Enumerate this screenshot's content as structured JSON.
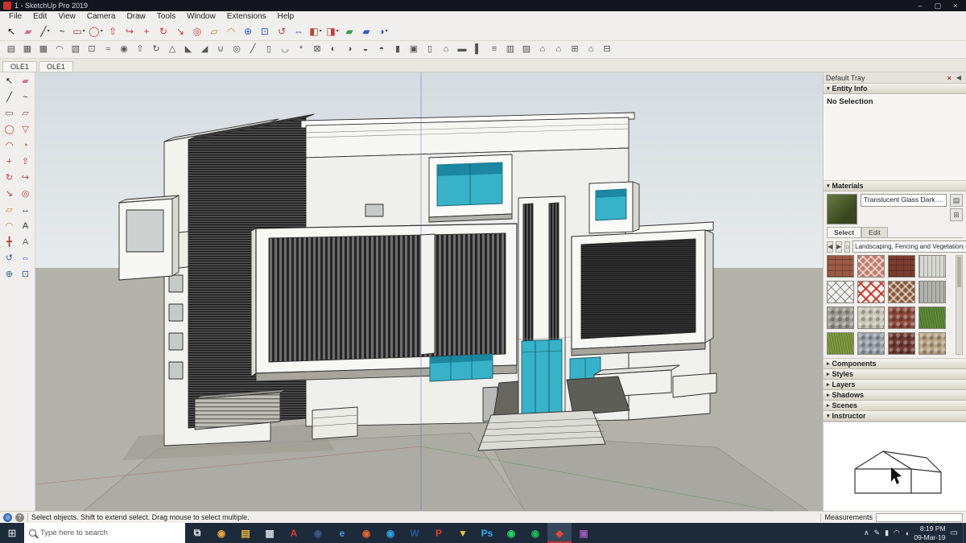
{
  "window": {
    "title": "1 - SketchUp Pro 2019",
    "controls": [
      {
        "name": "minimize-button",
        "glyph": "–"
      },
      {
        "name": "maximize-button",
        "glyph": "▢"
      },
      {
        "name": "close-button",
        "glyph": "×"
      }
    ]
  },
  "menu_bar": {
    "items": [
      "File",
      "Edit",
      "View",
      "Camera",
      "Draw",
      "Tools",
      "Window",
      "Extensions",
      "Help"
    ]
  },
  "toolbar_main": {
    "tools": [
      {
        "name": "select-tool",
        "glyph": "↖",
        "color": "#1b1b1b"
      },
      {
        "name": "eraser-tool",
        "glyph": "▰",
        "color": "#d4758c"
      },
      {
        "name": "line-tool",
        "glyph": "╱",
        "color": "#2b2b2b",
        "caret": true
      },
      {
        "name": "freehand-tool",
        "glyph": "~",
        "color": "#2b2b2b"
      },
      {
        "name": "rectangle-tool",
        "glyph": "▭",
        "color": "#9c4a3a",
        "caret": true
      },
      {
        "name": "circle-tool",
        "glyph": "◯",
        "color": "#c23b2e",
        "caret": true
      },
      {
        "name": "pushpull-tool",
        "glyph": "⇧",
        "color": "#c23b2e"
      },
      {
        "name": "followme-tool",
        "glyph": "↪",
        "color": "#c23b2e"
      },
      {
        "name": "move-tool",
        "glyph": "+",
        "color": "#c23b2e"
      },
      {
        "name": "rotate-tool",
        "glyph": "↻",
        "color": "#c23b2e"
      },
      {
        "name": "scale-tool",
        "glyph": "↘",
        "color": "#c23b2e"
      },
      {
        "name": "offset-tool",
        "glyph": "◎",
        "color": "#c23b2e"
      },
      {
        "name": "tape-measure-tool",
        "glyph": "▱",
        "color": "#b8872a"
      },
      {
        "name": "protractor-tool",
        "glyph": "◠",
        "color": "#b8872a"
      },
      {
        "name": "zoom-tool",
        "glyph": "⊕",
        "color": "#2a5ac0"
      },
      {
        "name": "zoom-extents-tool",
        "glyph": "⊡",
        "color": "#2a5ac0"
      },
      {
        "name": "orbit-tool",
        "glyph": "↺",
        "color": "#c23b2e"
      },
      {
        "name": "pan-tool",
        "glyph": "⇔",
        "color": "#2a5ac0"
      },
      {
        "name": "make-component-tool",
        "glyph": "◧",
        "color": "#c23b2e",
        "caret": true
      },
      {
        "name": "group-tool",
        "glyph": "◨",
        "color": "#c23b2e",
        "caret": true
      },
      {
        "name": "section-plane-tool",
        "glyph": "▰",
        "color": "#3a9a4a"
      },
      {
        "name": "section-display-tool",
        "glyph": "▰",
        "color": "#2a5ac0"
      },
      {
        "name": "shadows-toggle-tool",
        "glyph": "◑",
        "color": "#2a5ac0",
        "caret": true
      }
    ]
  },
  "toolbar_secondary": {
    "tools": [
      {
        "name": "offset-surface-tool",
        "glyph": "▤"
      },
      {
        "name": "quad-face-tool",
        "glyph": "▦"
      },
      {
        "name": "grid-tool",
        "glyph": "▩"
      },
      {
        "name": "soften-edges-tool",
        "glyph": "◠"
      },
      {
        "name": "drape-tool",
        "glyph": "▧"
      },
      {
        "name": "stamp-tool",
        "glyph": "⊡"
      },
      {
        "name": "from-contours-tool",
        "glyph": "≈"
      },
      {
        "name": "smoove-tool",
        "glyph": "◉"
      },
      {
        "name": "extrude-tool",
        "glyph": "⇧"
      },
      {
        "name": "lathe-tool",
        "glyph": "↻"
      },
      {
        "name": "taper-tool",
        "glyph": "△"
      },
      {
        "name": "bevel-tool",
        "glyph": "◣"
      },
      {
        "name": "chamfer-tool",
        "glyph": "◢"
      },
      {
        "name": "loft-tool",
        "glyph": "∪"
      },
      {
        "name": "pipe-tool",
        "glyph": "◎"
      },
      {
        "name": "slice-tool",
        "glyph": "╱"
      },
      {
        "name": "mirror-tool",
        "glyph": "▯"
      },
      {
        "name": "weld-edges-tool",
        "glyph": "◡"
      },
      {
        "name": "explode-tool",
        "glyph": "*"
      },
      {
        "name": "intersect-faces-tool",
        "glyph": "⊠"
      },
      {
        "name": "solid-union-tool",
        "glyph": "◐"
      },
      {
        "name": "solid-subtract-tool",
        "glyph": "◑"
      },
      {
        "name": "solid-trim-tool",
        "glyph": "◒"
      },
      {
        "name": "solid-intersect-tool",
        "glyph": "◓"
      },
      {
        "name": "wall-tool",
        "glyph": "▮"
      },
      {
        "name": "window-tool",
        "glyph": "▣"
      },
      {
        "name": "door-tool",
        "glyph": "▯"
      },
      {
        "name": "roof-tool",
        "glyph": "⌂"
      },
      {
        "name": "floor-tool",
        "glyph": "▬"
      },
      {
        "name": "column-tool",
        "glyph": "▌"
      },
      {
        "name": "stairs-tool",
        "glyph": "≡"
      },
      {
        "name": "fence-tool",
        "glyph": "▥"
      },
      {
        "name": "hatch-pattern-tool",
        "glyph": "▨"
      },
      {
        "name": "component-house-tool",
        "glyph": "⌂"
      },
      {
        "name": "3d-warehouse-tool",
        "glyph": "⌂"
      },
      {
        "name": "share-model-tool",
        "glyph": "⊞"
      },
      {
        "name": "model-info-tool",
        "glyph": "⌂"
      },
      {
        "name": "print-tool",
        "glyph": "⊟"
      }
    ]
  },
  "scene_tabs": [
    "OLE1",
    "OLE1"
  ],
  "left_toolbar": {
    "tools": [
      {
        "name": "select-tool",
        "glyph": "↖",
        "color": "#1b1b1b"
      },
      {
        "name": "eraser-tool",
        "glyph": "▰",
        "color": "#d4758c"
      },
      {
        "name": "line-tool",
        "glyph": "╱",
        "color": "#2b2b2b"
      },
      {
        "name": "freehand-tool",
        "glyph": "~",
        "color": "#2b2b2b"
      },
      {
        "name": "rectangle-tool",
        "glyph": "▭",
        "color": "#9c4a3a"
      },
      {
        "name": "rotated-rectangle-tool",
        "glyph": "▱",
        "color": "#9c4a3a"
      },
      {
        "name": "circle-tool",
        "glyph": "◯",
        "color": "#c23b2e"
      },
      {
        "name": "polygon-tool",
        "glyph": "▽",
        "color": "#c23b2e"
      },
      {
        "name": "arc-tool",
        "glyph": "◠",
        "color": "#c23b2e"
      },
      {
        "name": "pie-tool",
        "glyph": "◔",
        "color": "#c23b2e"
      },
      {
        "name": "move-tool",
        "glyph": "+",
        "color": "#c23b2e"
      },
      {
        "name": "pushpull-tool",
        "glyph": "⇧",
        "color": "#c23b2e"
      },
      {
        "name": "rotate-tool",
        "glyph": "↻",
        "color": "#c23b2e"
      },
      {
        "name": "followme-tool",
        "glyph": "↪",
        "color": "#c23b2e"
      },
      {
        "name": "scale-tool",
        "glyph": "↘",
        "color": "#c23b2e"
      },
      {
        "name": "offset-tool",
        "glyph": "◎",
        "color": "#c23b2e"
      },
      {
        "name": "tape-measure-tool",
        "glyph": "▱",
        "color": "#b8872a"
      },
      {
        "name": "dimension-tool",
        "glyph": "↔",
        "color": "#2b2b2b"
      },
      {
        "name": "protractor-tool",
        "glyph": "◠",
        "color": "#b8872a"
      },
      {
        "name": "text-tool",
        "glyph": "A",
        "color": "#2b2b2b"
      },
      {
        "name": "axes-tool",
        "glyph": "╋",
        "color": "#c23b2e"
      },
      {
        "name": "3d-text-tool",
        "glyph": "A",
        "color": "#666666"
      },
      {
        "name": "orbit-tool",
        "glyph": "↺",
        "color": "#2a5ac0"
      },
      {
        "name": "pan-tool",
        "glyph": "⇔",
        "color": "#2a5ac0"
      },
      {
        "name": "zoom-tool",
        "glyph": "⊕",
        "color": "#2a5ac0"
      },
      {
        "name": "zoom-extents-tool",
        "glyph": "⊡",
        "color": "#2a5ac0"
      }
    ]
  },
  "tray": {
    "title": "Default Tray",
    "close_glyph": "×",
    "hide_glyph": "◀",
    "entity_info": {
      "label": "Entity Info",
      "arrow": "▾",
      "status": "No Selection"
    },
    "materials": {
      "label": "Materials",
      "arrow": "▾",
      "material_name": "Translucent Glass Dark Green",
      "preview_color": "#55682f",
      "tabs": [
        {
          "name": "materials-tab-select",
          "label": "Select",
          "state": "active"
        },
        {
          "name": "materials-tab-edit",
          "label": "Edit"
        }
      ],
      "back_glyph": "◀",
      "forward_glyph": "▶",
      "in_model_glyph": "⌂",
      "category": "Landscaping, Fencing and Vegetation",
      "dropdown_arrow": "▾",
      "sample_paint_glyph": "✎",
      "display_pane_glyph": "▤",
      "create_material_glyph": "⊞",
      "swatches": [
        {
          "name": "swatch-brick-rough",
          "base": "#9b5a44",
          "pattern": "brick"
        },
        {
          "name": "swatch-lattice-red",
          "base": "#c47a6a",
          "pattern": "lattice"
        },
        {
          "name": "swatch-brick-dark",
          "base": "#7a3c2f",
          "pattern": "brick"
        },
        {
          "name": "swatch-fence-white",
          "base": "#d9d9d4",
          "pattern": "vlines"
        },
        {
          "name": "swatch-lattice-white",
          "base": "#efefec",
          "pattern": "diamond"
        },
        {
          "name": "swatch-lattice-open-red",
          "base": "#f4f0ea",
          "pattern": "diamond-red"
        },
        {
          "name": "swatch-lattice-brown",
          "base": "#8a5a3c",
          "pattern": "lattice"
        },
        {
          "name": "swatch-boards-gray",
          "base": "#b3b3ad",
          "pattern": "vlines"
        },
        {
          "name": "swatch-stone-gray",
          "base": "#9a9a90",
          "pattern": "stones"
        },
        {
          "name": "swatch-pebbles-light",
          "base": "#c9c5b8",
          "pattern": "stones"
        },
        {
          "name": "swatch-gravel-red",
          "base": "#8d4a3c",
          "pattern": "stones"
        },
        {
          "name": "swatch-grass-green",
          "base": "#5e8a3a",
          "pattern": "grass"
        },
        {
          "name": "swatch-grass-olive",
          "base": "#7f9a3f",
          "pattern": "grass"
        },
        {
          "name": "swatch-stone-blue",
          "base": "#98a2a8",
          "pattern": "stones"
        },
        {
          "name": "swatch-gravel-dark",
          "base": "#6e3a32",
          "pattern": "stones"
        },
        {
          "name": "swatch-sand-tan",
          "base": "#b5a484",
          "pattern": "stones"
        }
      ]
    },
    "sections": [
      {
        "name": "tray-section-components",
        "label": "Components",
        "arrow": "▸"
      },
      {
        "name": "tray-section-styles",
        "label": "Styles",
        "arrow": "▸"
      },
      {
        "name": "tray-section-layers",
        "label": "Layers",
        "arrow": "▸"
      },
      {
        "name": "tray-section-shadows",
        "label": "Shadows",
        "arrow": "▸"
      },
      {
        "name": "tray-section-scenes",
        "label": "Scenes",
        "arrow": "▸"
      }
    ],
    "instructor": {
      "label": "Instructor",
      "arrow": "▾"
    }
  },
  "status_bar": {
    "message": "Select objects. Shift to extend select. Drag mouse to select multiple.",
    "measurements_label": "Measurements",
    "measurements_value": ""
  },
  "taskbar": {
    "start_glyph": "⊞",
    "search_placeholder": "Type here to search",
    "apps": [
      {
        "name": "task-view-button",
        "glyph": "⧉",
        "color": "#dfe3e8"
      },
      {
        "name": "chrome-icon",
        "glyph": "◉",
        "color": "#e8a33c"
      },
      {
        "name": "file-explorer-icon",
        "glyph": "▤",
        "color": "#e8b339"
      },
      {
        "name": "calculator-icon",
        "glyph": "▦",
        "color": "#cfd8dc"
      },
      {
        "name": "acrobat-icon",
        "glyph": "A",
        "color": "#e03c31"
      },
      {
        "name": "steam-icon",
        "glyph": "◉",
        "color": "#3b5a80"
      },
      {
        "name": "edge-icon",
        "glyph": "e",
        "color": "#3ca0e0"
      },
      {
        "name": "firefox-icon",
        "glyph": "◉",
        "color": "#e0662c"
      },
      {
        "name": "telegram-icon",
        "glyph": "◉",
        "color": "#2aa3df"
      },
      {
        "name": "word-icon",
        "glyph": "W",
        "color": "#2b579a"
      },
      {
        "name": "powerpoint-icon",
        "glyph": "P",
        "color": "#d24726"
      },
      {
        "name": "downloads-icon",
        "glyph": "▼",
        "color": "#f0c030"
      },
      {
        "name": "photoshop-icon",
        "glyph": "Ps",
        "color": "#31a8ff"
      },
      {
        "name": "whatsapp-icon",
        "glyph": "◉",
        "color": "#25d366"
      },
      {
        "name": "spotify-icon",
        "glyph": "◉",
        "color": "#1db954"
      },
      {
        "name": "sketchup-icon",
        "glyph": "◆",
        "color": "#e04a3a",
        "state": "active"
      },
      {
        "name": "photos-icon",
        "glyph": "▣",
        "color": "#9b59b6"
      }
    ],
    "tray_icons": [
      {
        "name": "hidden-icons-chevron",
        "glyph": "∧"
      },
      {
        "name": "pen-icon",
        "glyph": "✎"
      },
      {
        "name": "battery-icon",
        "glyph": "▮"
      },
      {
        "name": "network-icon",
        "glyph": "◠"
      },
      {
        "name": "volume-icon",
        "glyph": "◖"
      }
    ],
    "tray_time": "8:19 PM",
    "tray_date": "09-Mar-19",
    "action_center_glyph": "▭"
  }
}
